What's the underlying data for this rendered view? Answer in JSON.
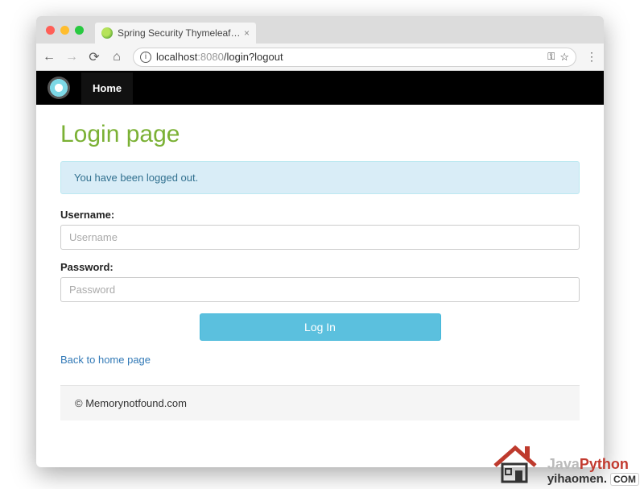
{
  "browser": {
    "tab_title": "Spring Security Thymeleaf - Lo",
    "url_host_muted": "localhost",
    "url_port_muted": ":8080",
    "url_path": "/login?logout"
  },
  "nav": {
    "home": "Home"
  },
  "page": {
    "heading": "Login page",
    "alert": "You have been logged out.",
    "username_label": "Username:",
    "username_placeholder": "Username",
    "password_label": "Password:",
    "password_placeholder": "Password",
    "submit_label": "Log In",
    "back_link": "Back to home page",
    "footer": "© Memorynotfound.com"
  },
  "watermark": {
    "line1_gray": "Java",
    "line1_red": "Python",
    "line2_text": "yihaomen.",
    "line2_badge": "COM"
  }
}
